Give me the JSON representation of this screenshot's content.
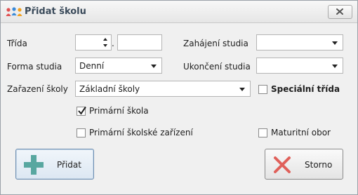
{
  "window": {
    "title": "Přidat školu"
  },
  "form": {
    "trida": {
      "label": "Třída",
      "number_value": "",
      "separator": ".",
      "letter_value": ""
    },
    "zahajeni": {
      "label": "Zahájení studia",
      "value": ""
    },
    "forma": {
      "label": "Forma studia",
      "value": "Denní"
    },
    "ukonceni": {
      "label": "Ukončení studia",
      "value": ""
    },
    "zarazeni": {
      "label": "Zařazení školy",
      "value": "Základní školy"
    },
    "specialni": {
      "label": "Speciální třída",
      "checked": false
    },
    "primarni_skola": {
      "label": "Primární škola",
      "checked": true
    },
    "primarni_zarizeni": {
      "label": "Primární školské zařízení",
      "checked": false
    },
    "maturitni": {
      "label": "Maturitní obor",
      "checked": false
    }
  },
  "buttons": {
    "add_label": "Přidat",
    "cancel_label": "Storno"
  },
  "colors": {
    "add_icon": "#58a7a0",
    "cancel_icon": "#e0605a"
  },
  "icons": {
    "app": "people-group-icon",
    "close": "close-icon",
    "add": "plus-icon",
    "cancel": "x-icon"
  }
}
